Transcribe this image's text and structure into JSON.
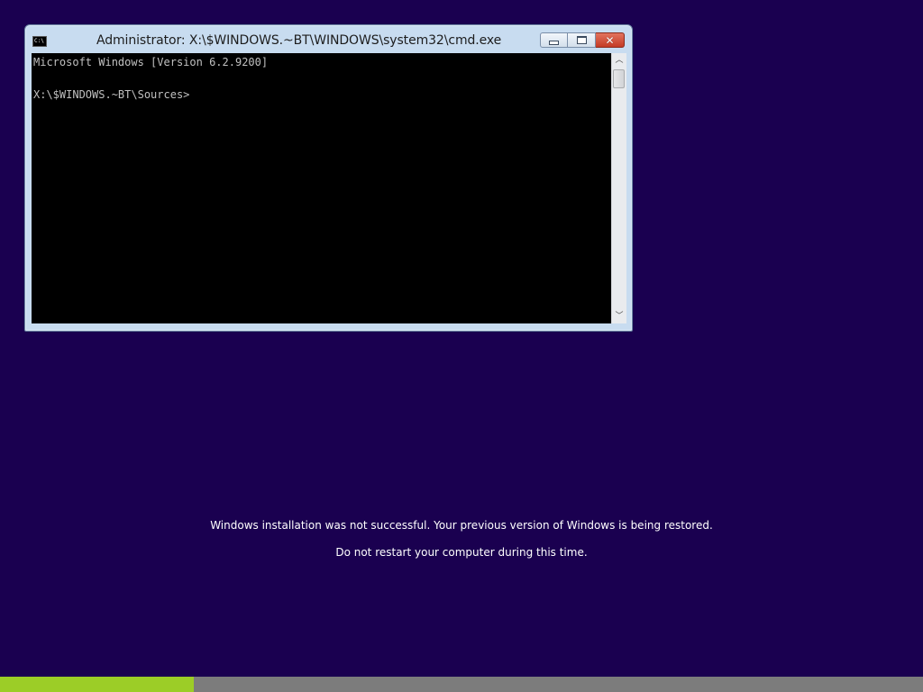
{
  "window": {
    "title": "Administrator: X:\\$WINDOWS.~BT\\WINDOWS\\system32\\cmd.exe",
    "icon": "cmd-icon",
    "icon_text": "C:\\",
    "buttons": {
      "minimize": "minimize-icon",
      "maximize": "maximize-icon",
      "close": "close-icon",
      "close_glyph": "✕"
    }
  },
  "console": {
    "text": "Microsoft Windows [Version 6.2.9200]\n\nX:\\$WINDOWS.~BT\\Sources>"
  },
  "scrollbar": {
    "up_glyph": "︿",
    "down_glyph": "﹀"
  },
  "status": {
    "line1": "Windows installation was not successful.  Your previous version of Windows is being restored.",
    "line2": "Do not restart your computer during this time."
  },
  "progress": {
    "fraction": 0.21
  },
  "colors": {
    "background": "#1a0050",
    "progress_fill": "#9ccd27",
    "progress_track": "#7c7c7c",
    "console_bg": "#000000",
    "console_fg": "#c0c0c0"
  }
}
